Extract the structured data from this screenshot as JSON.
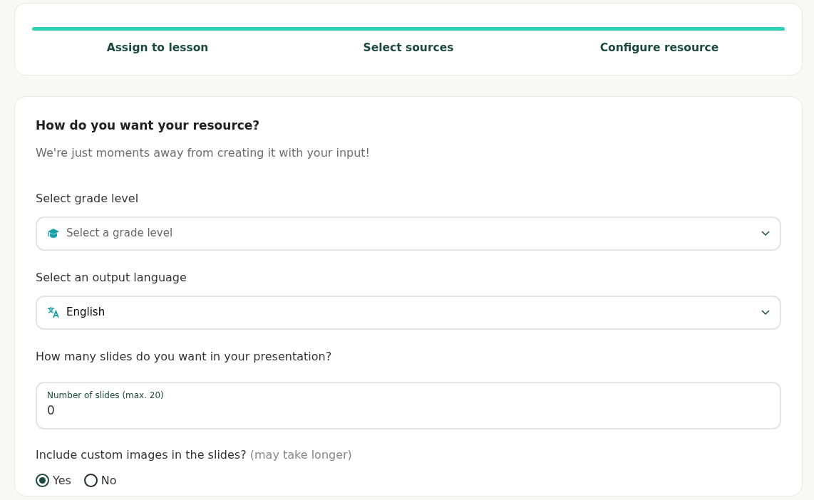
{
  "progress": {
    "level": 1
  },
  "steps": [
    {
      "label": "Assign to lesson"
    },
    {
      "label": "Select sources"
    },
    {
      "label": "Configure resource"
    }
  ],
  "form": {
    "title": "How do you want your resource?",
    "subtitle": "We're just moments away from creating it with your input!",
    "fields": [
      {
        "kind": "select",
        "label": "Select grade level",
        "placeholder": "Select a grade level"
      },
      {
        "kind": "select",
        "label": "Select an output language",
        "value": "English"
      },
      {
        "kind": "number",
        "label": "How many slides do you want in your presentation?",
        "floating_label": "Number of slides (max. 20)",
        "value": "0"
      },
      {
        "kind": "radio",
        "label": "Include custom images in the slides?",
        "hint": "(may take longer)",
        "options": [
          {
            "label": "Yes",
            "selected": true
          },
          {
            "label": "No",
            "selected": false
          }
        ]
      }
    ]
  }
}
